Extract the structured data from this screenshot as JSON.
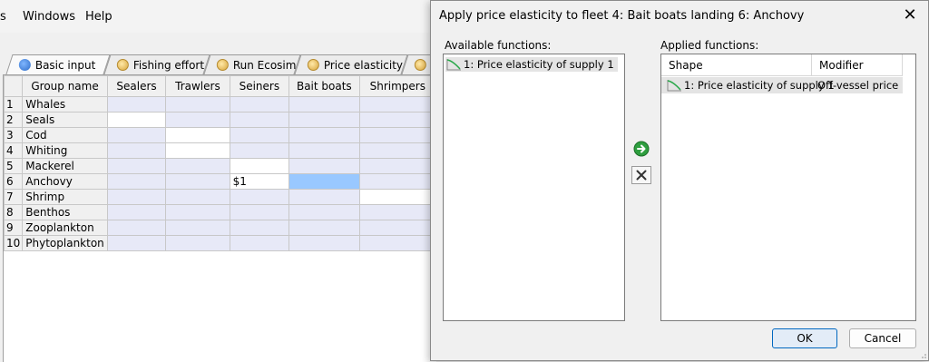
{
  "menubar": {
    "items": [
      "s",
      "Windows",
      "Help"
    ]
  },
  "tabs": [
    {
      "label": "Basic input",
      "icon": "globe-icon"
    },
    {
      "label": "Fishing effort",
      "icon": "fish-icon"
    },
    {
      "label": "Run Ecosim",
      "icon": "fish-icon"
    },
    {
      "label": "Price elasticity",
      "icon": "fish-icon"
    }
  ],
  "grid": {
    "columns": [
      "Group name",
      "Sealers",
      "Trawlers",
      "Seiners",
      "Bait boats",
      "Shrimpers"
    ],
    "rows": [
      {
        "n": "1",
        "name": "Whales"
      },
      {
        "n": "2",
        "name": "Seals"
      },
      {
        "n": "3",
        "name": "Cod"
      },
      {
        "n": "4",
        "name": "Whiting"
      },
      {
        "n": "5",
        "name": "Mackerel"
      },
      {
        "n": "6",
        "name": "Anchovy"
      },
      {
        "n": "7",
        "name": "Shrimp"
      },
      {
        "n": "8",
        "name": "Benthos"
      },
      {
        "n": "9",
        "name": "Zooplankton"
      },
      {
        "n": "10",
        "name": "Phytoplankton"
      }
    ],
    "anchovy_seiners_value": "$1"
  },
  "dialog": {
    "title": "Apply price elasticity to fleet 4: Bait boats landing 6: Anchovy",
    "available_label": "Available functions:",
    "available_items": [
      "1: Price elasticity of supply 1"
    ],
    "applied_label": "Applied functions:",
    "applied_columns": [
      "Shape",
      "Modifier"
    ],
    "applied_rows": [
      {
        "shape": "1: Price elasticity of supply 1",
        "modifier": "Off-vessel price"
      }
    ],
    "ok": "OK",
    "cancel": "Cancel"
  }
}
